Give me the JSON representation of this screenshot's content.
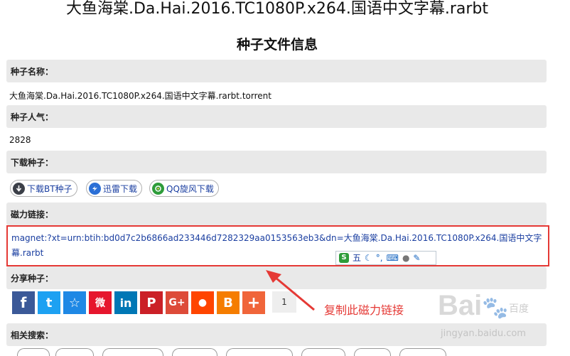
{
  "page": {
    "title": "大鱼海棠.Da.Hai.2016.TC1080P.x264.国语中文字幕.rarbt",
    "section_title": "种子文件信息"
  },
  "torrent_name": {
    "label": "种子名称：",
    "value": "大鱼海棠.Da.Hai.2016.TC1080P.x264.国语中文字幕.rarbt.torrent"
  },
  "popularity": {
    "label": "种子人气：",
    "value": "2828"
  },
  "download": {
    "label": "下载种子：",
    "buttons": [
      {
        "label": "下载BT种子",
        "icon": "download-circle-icon",
        "color": "#3b3f48"
      },
      {
        "label": "迅雷下载",
        "icon": "thunder-bird-icon",
        "color": "#2b6fd6"
      },
      {
        "label": "QQ旋风下载",
        "icon": "qq-whirlwind-icon",
        "color": "#2e9c3a"
      }
    ]
  },
  "magnet": {
    "label": "磁力链接：",
    "value": "magnet:?xt=urn:btih:bd0d7c2b6866ad233446d7282329aa0153563eb3&dn=大鱼海棠.Da.Hai.2016.TC1080P.x264.国语中文字幕.rarbt",
    "highlight_color": "#e53935"
  },
  "ime_toolbar": {
    "mode_label": "五",
    "icons": [
      "sogou-s-icon",
      "moon-icon",
      "punctuation-icon",
      "keyboard-icon",
      "user-icon",
      "wrench-icon"
    ]
  },
  "share": {
    "label": "分享种子：",
    "buttons": [
      {
        "name": "facebook",
        "glyph": "f",
        "color": "#3b5998"
      },
      {
        "name": "twitter",
        "glyph": "t",
        "color": "#1da1f2"
      },
      {
        "name": "favorites",
        "glyph": "☆",
        "color": "#1e88e5"
      },
      {
        "name": "weibo",
        "glyph": "微",
        "color": "#e6162d"
      },
      {
        "name": "linkedin",
        "glyph": "in",
        "color": "#0077b5"
      },
      {
        "name": "pinterest",
        "glyph": "P",
        "color": "#cb2027"
      },
      {
        "name": "google-plus",
        "glyph": "G+",
        "color": "#dd4b39"
      },
      {
        "name": "reddit",
        "glyph": "●",
        "color": "#ff4500"
      },
      {
        "name": "blogger",
        "glyph": "B",
        "color": "#f57d00"
      },
      {
        "name": "more",
        "glyph": "+",
        "color": "#f0653a"
      }
    ],
    "count": "1"
  },
  "annotation": {
    "text": "复制此磁力链接",
    "color": "#e53935"
  },
  "related": {
    "label": "相关搜索："
  },
  "watermark": {
    "brand": "Bai",
    "brand_suffix": "百度",
    "sub": "jingyan.baidu.com"
  }
}
